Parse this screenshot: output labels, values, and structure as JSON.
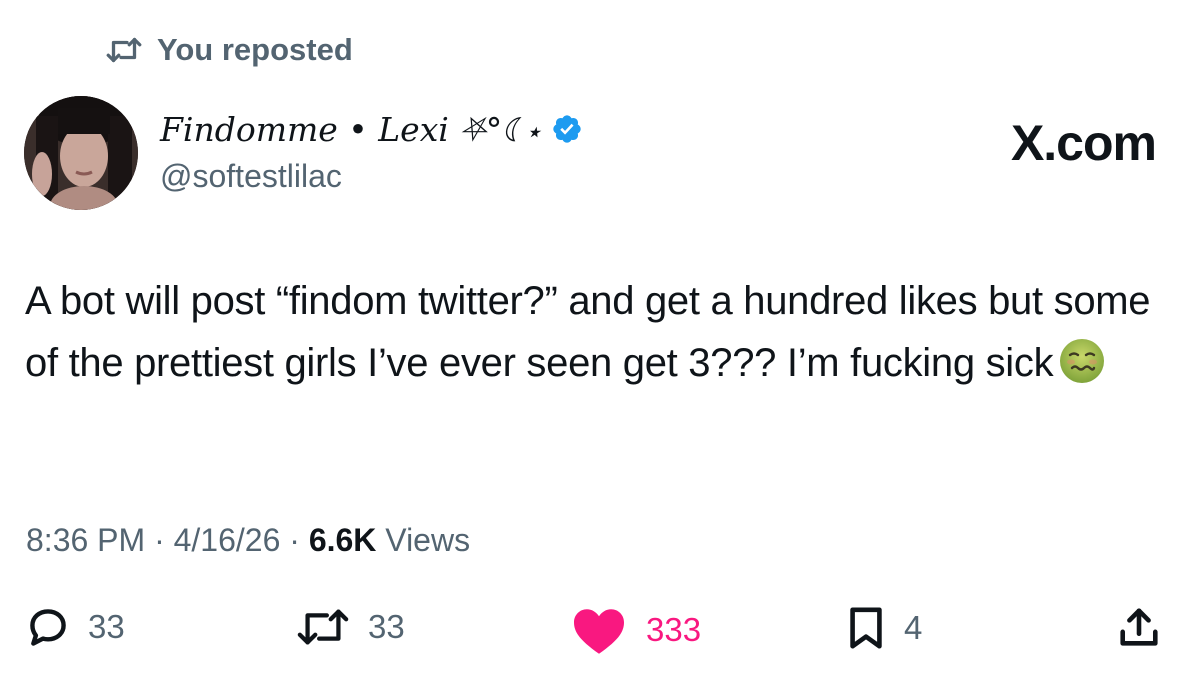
{
  "repost": {
    "label": "You reposted"
  },
  "author": {
    "display_name": "Findomme • Lexi ⛧°☾⋆",
    "handle": "@softestlilac",
    "verified": true
  },
  "brand": {
    "label": "X.com"
  },
  "tweet": {
    "text": "A bot will post “findom twitter?” and get a hundred likes but some of the prettiest girls I’ve ever seen get 3??? I’m fucking sick",
    "emoji": "nauseated-face"
  },
  "meta": {
    "time": "8:36 PM",
    "sep1": " · ",
    "date": "4/16/26",
    "sep2": " · ",
    "views_count": "6.6K",
    "views_label": " Views"
  },
  "actions": {
    "replies": "33",
    "reposts": "33",
    "likes": "333",
    "bookmarks": "4"
  },
  "colors": {
    "text": "#0f1419",
    "secondary": "#536471",
    "like": "#f91880",
    "verified": "#1d9bf0"
  }
}
